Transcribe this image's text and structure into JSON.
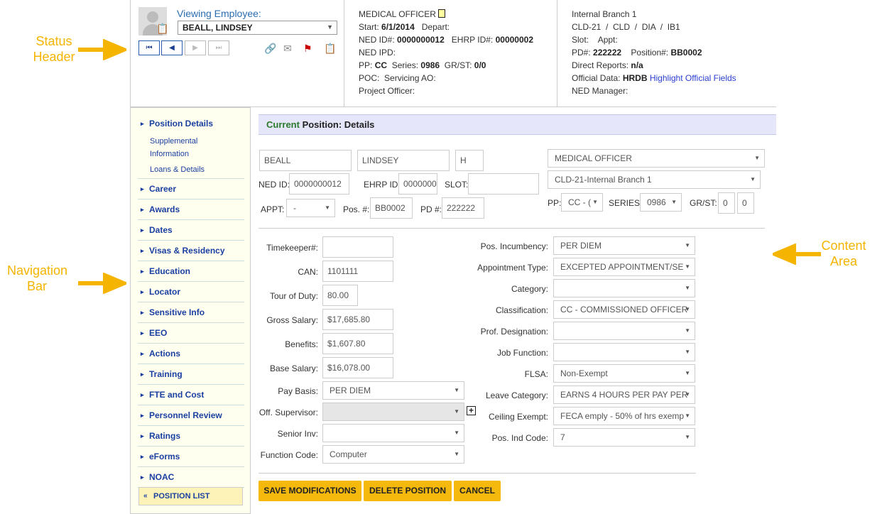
{
  "callouts": {
    "status_header": [
      "Status",
      "Header"
    ],
    "navigation_bar": [
      "Navigation",
      "Bar"
    ],
    "content_area": [
      "Content",
      "Area"
    ]
  },
  "header": {
    "viewing_label": "Viewing Employee:",
    "employee_name": "BEALL, LINDSEY",
    "col2": {
      "title": "MEDICAL OFFICER",
      "start_label": "Start:",
      "start_value": "6/1/2014",
      "depart_label": "Depart:",
      "ned_label": "NED ID#:",
      "ned_value": "0000000012",
      "ehrp_label": "EHRP ID#:",
      "ehrp_value": "00000002",
      "ned_ipd_label": "NED IPD:",
      "pp_label": "PP:",
      "pp_value": "CC",
      "series_label": "Series:",
      "series_value": "0986",
      "grst_label": "GR/ST:",
      "grst_value": "0/0",
      "poc_label": "POC:",
      "poc_value": "Servicing AO:",
      "project_officer_label": "Project Officer:"
    },
    "col3": {
      "branch": "Internal Branch 1",
      "org_path": "CLD-21  /  CLD  /  DIA  /  IB1",
      "slot_label": "Slot:",
      "appt_label": "Appt:",
      "pd_label": "PD#:",
      "pd_value": "222222",
      "position_label": "Position#:",
      "position_value": "BB0002",
      "direct_reports_label": "Direct Reports:",
      "direct_reports_value": "n/a",
      "official_data_label": "Official Data:",
      "official_data_value": "HRDB",
      "highlight_link": "Highlight Official Fields",
      "ned_manager_label": "NED Manager:"
    }
  },
  "sidebar": {
    "items": [
      {
        "label": "Position Details",
        "top": 0
      },
      {
        "label": "Career"
      },
      {
        "label": "Awards"
      },
      {
        "label": "Dates"
      },
      {
        "label": "Visas & Residency"
      },
      {
        "label": "Education"
      },
      {
        "label": "Locator"
      },
      {
        "label": "Sensitive Info"
      },
      {
        "label": "EEO"
      },
      {
        "label": "Actions"
      },
      {
        "label": "Training"
      },
      {
        "label": "FTE and Cost"
      },
      {
        "label": "Personnel Review"
      },
      {
        "label": "Ratings"
      },
      {
        "label": "eForms"
      },
      {
        "label": "NOAC"
      }
    ],
    "sub_supplemental_1": "Supplemental",
    "sub_supplemental_2": "Information",
    "sub_loans": "Loans & Details",
    "position_list": "POSITION LIST"
  },
  "content": {
    "header_green": "Current",
    "header_rest": " Position: Details",
    "top": {
      "last_name": "BEALL",
      "first_name": "LINDSEY",
      "middle": "H",
      "title_select": "MEDICAL OFFICER",
      "org_select": "CLD-21-Internal Branch 1",
      "ned_id_label": "NED ID:",
      "ned_id_value": "0000000012",
      "ehrp_id_label": "EHRP ID:",
      "ehrp_id_value": "0000000",
      "slot_label": "SLOT:",
      "slot_value": "",
      "appt_label": "APPT:",
      "appt_value": "-",
      "pos_label": "Pos. #:",
      "pos_value": "BB0002",
      "pd_label": "PD #:",
      "pd_value": "222222",
      "pp_label": "PP:",
      "pp_value": "CC - (",
      "series_label": "SERIES:",
      "series_value": "0986",
      "grst_label": "GR/ST:",
      "gr_value": "0",
      "st_value": "0"
    },
    "left_fields": {
      "timekeeper_label": "Timekeeper#:",
      "timekeeper_value": "",
      "can_label": "CAN:",
      "can_value": "1101111",
      "tour_label": "Tour of Duty:",
      "tour_value": "80.00",
      "gross_label": "Gross Salary:",
      "gross_value": "$17,685.80",
      "benefits_label": "Benefits:",
      "benefits_value": "$1,607.80",
      "base_label": "Base Salary:",
      "base_value": "$16,078.00",
      "paybasis_label": "Pay Basis:",
      "paybasis_value": "PER DIEM",
      "offsup_label": "Off. Supervisor:",
      "offsup_value": "",
      "senior_label": "Senior Inv:",
      "senior_value": "",
      "function_label": "Function Code:",
      "function_value": "Computer"
    },
    "right_fields": {
      "incumbency_label": "Pos. Incumbency:",
      "incumbency_value": "PER DIEM",
      "appttype_label": "Appointment Type:",
      "appttype_value": "EXCEPTED APPOINTMENT/SE",
      "category_label": "Category:",
      "category_value": "",
      "classification_label": "Classification:",
      "classification_value": "CC - COMMISSIONED OFFICER",
      "profdes_label": "Prof. Designation:",
      "profdes_value": "",
      "jobfn_label": "Job Function:",
      "jobfn_value": "",
      "flsa_label": "FLSA:",
      "flsa_value": "Non-Exempt",
      "leave_label": "Leave Category:",
      "leave_value": "EARNS 4 HOURS PER PAY PER",
      "ceiling_label": "Ceiling Exempt:",
      "ceiling_value": "FECA emply - 50% of hrs exemp",
      "posind_label": "Pos. Ind Code:",
      "posind_value": "7"
    },
    "buttons": {
      "save": "SAVE MODIFICATIONS",
      "delete": "DELETE POSITION",
      "cancel": "CANCEL"
    }
  },
  "colors": {
    "accent": "#f5b90d",
    "link": "#1a3fa0",
    "header_bg": "#e6e6fa",
    "sidebar_bg": "#fffff0"
  }
}
